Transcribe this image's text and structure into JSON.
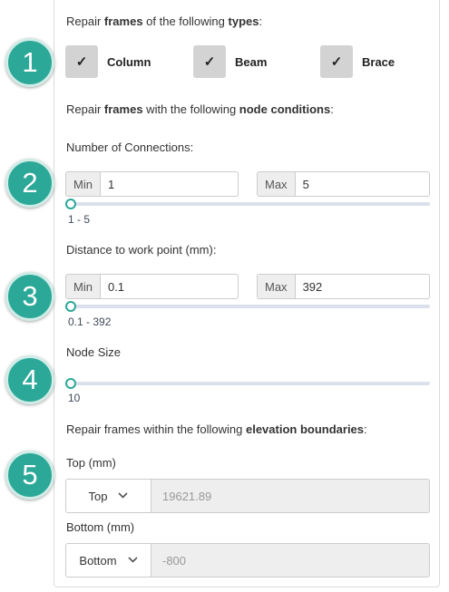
{
  "step_badges": [
    "1",
    "2",
    "3",
    "4",
    "5"
  ],
  "frame_types": {
    "heading_parts": [
      "Repair ",
      "frames",
      " of the following ",
      "types",
      ":"
    ],
    "options": [
      {
        "label": "Column",
        "checked": true,
        "check_glyph": "✓"
      },
      {
        "label": "Beam",
        "checked": true,
        "check_glyph": "✓"
      },
      {
        "label": "Brace",
        "checked": true,
        "check_glyph": "✓"
      }
    ]
  },
  "node_conditions": {
    "heading_parts": [
      "Repair ",
      "frames",
      " with the following ",
      "node conditions",
      ":"
    ],
    "connections": {
      "label": "Number of Connections:",
      "min_label": "Min",
      "min_value": "1",
      "max_label": "Max",
      "max_value": "5",
      "range_text": "1 - 5",
      "slider_fraction": 0
    },
    "distance": {
      "label": "Distance to work point (mm):",
      "min_label": "Min",
      "min_value": "0.1",
      "max_label": "Max",
      "max_value": "392",
      "range_text": "0.1 - 392",
      "slider_fraction": 0
    },
    "node_size": {
      "label": "Node Size",
      "value_text": "10",
      "slider_fraction": 0
    }
  },
  "elevation": {
    "heading_parts": [
      "Repair frames within the following ",
      "elevation boundaries",
      ":"
    ],
    "top": {
      "label": "Top (mm)",
      "select_value": "Top",
      "value": "19621.89"
    },
    "bottom": {
      "label": "Bottom (mm)",
      "select_value": "Bottom",
      "value": "-800"
    }
  },
  "colors": {
    "accent": "#2ba898",
    "checkbox_bg": "#d3d3d3",
    "track": "#dbe1ec"
  }
}
